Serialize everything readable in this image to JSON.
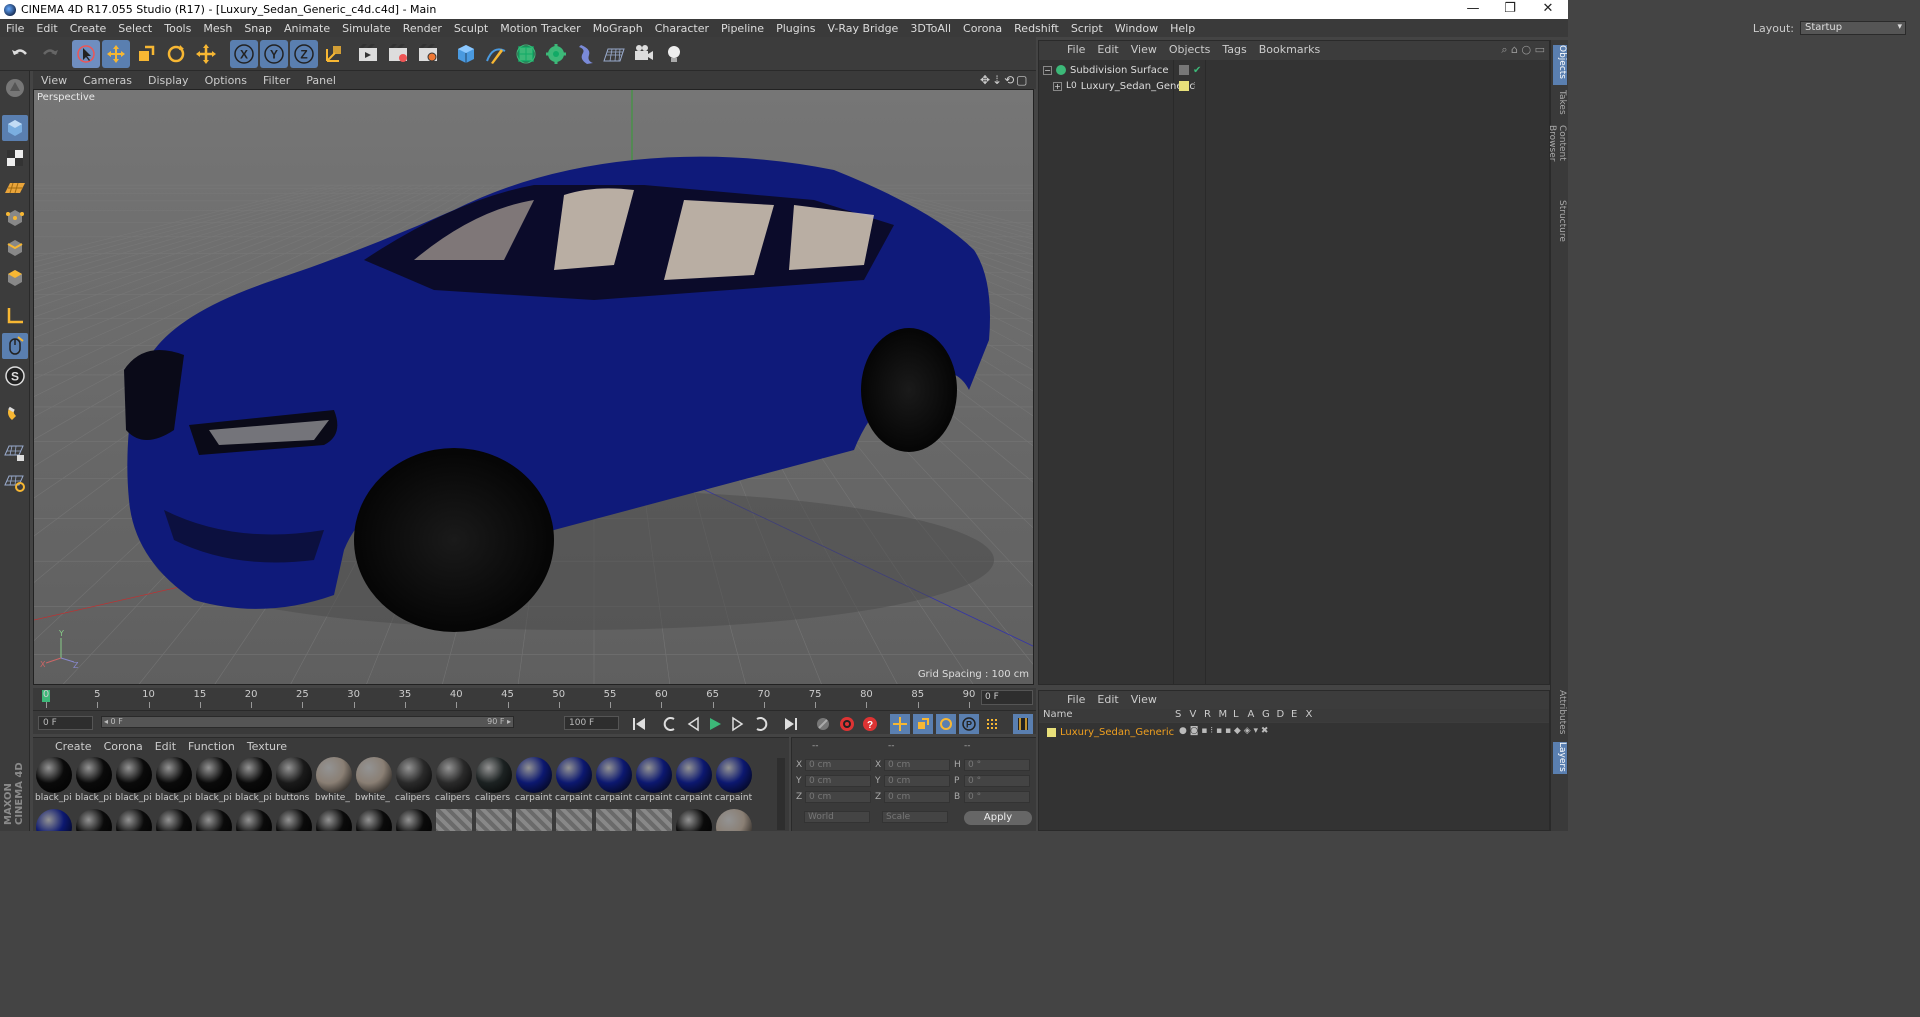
{
  "window": {
    "title": "CINEMA 4D R17.055 Studio (R17) - [Luxury_Sedan_Generic_c4d.c4d] - Main",
    "minimize": "—",
    "restore": "❐",
    "close": "✕"
  },
  "menu": [
    "File",
    "Edit",
    "Create",
    "Select",
    "Tools",
    "Mesh",
    "Snap",
    "Animate",
    "Simulate",
    "Render",
    "Sculpt",
    "Motion Tracker",
    "MoGraph",
    "Character",
    "Pipeline",
    "Plugins",
    "V-Ray Bridge",
    "3DToAll",
    "Corona",
    "Redshift",
    "Script",
    "Window",
    "Help"
  ],
  "layout": {
    "label": "Layout:",
    "value": "Startup"
  },
  "viewport": {
    "menu": [
      "View",
      "Cameras",
      "Display",
      "Options",
      "Filter",
      "Panel"
    ],
    "label": "Perspective",
    "grid_spacing": "Grid Spacing : 100 cm",
    "car_color": "#0f1a7a"
  },
  "timeline": {
    "ticks": [
      "0",
      "5",
      "10",
      "15",
      "20",
      "25",
      "30",
      "35",
      "40",
      "45",
      "50",
      "55",
      "60",
      "65",
      "70",
      "75",
      "80",
      "85",
      "90"
    ],
    "frame_field": "0 F",
    "start_field": "0 F",
    "slider_start": "◂ 0 F",
    "slider_end": "90 F ▸",
    "end_field": "100 F"
  },
  "materials": {
    "menu": [
      "Create",
      "Corona",
      "Edit",
      "Function",
      "Texture"
    ],
    "row1": [
      {
        "label": "black_pi",
        "color": "#0a0a0a"
      },
      {
        "label": "black_pi",
        "color": "#0a0a0a"
      },
      {
        "label": "black_pi",
        "color": "#0a0a0a"
      },
      {
        "label": "black_pi",
        "color": "#0a0a0a"
      },
      {
        "label": "black_pi",
        "color": "#0a0a0a"
      },
      {
        "label": "black_pi",
        "color": "#0a0a0a"
      },
      {
        "label": "buttons",
        "color": "#1a1a1a"
      },
      {
        "label": "bwhite_",
        "color": "#8a7f74"
      },
      {
        "label": "bwhite_",
        "color": "#8a7f74"
      },
      {
        "label": "calipers",
        "color": "#2a2a2a"
      },
      {
        "label": "calipers",
        "color": "#2a2a2a"
      },
      {
        "label": "calipers",
        "color": "#1c2222"
      },
      {
        "label": "carpaint",
        "color": "#0c1870"
      },
      {
        "label": "carpaint",
        "color": "#0c1870"
      },
      {
        "label": "carpaint",
        "color": "#0c1870"
      },
      {
        "label": "carpaint",
        "color": "#0c1870"
      },
      {
        "label": "carpaint",
        "color": "#0c1870"
      },
      {
        "label": "carpaint",
        "color": "#0c1870"
      }
    ],
    "row2": [
      "#0c1870",
      "#0a0a0a",
      "#0a0a0a",
      "#0a0a0a",
      "#0a0a0a",
      "#0a0a0a",
      "#0a0a0a",
      "#0a0a0a",
      "#0a0a0a",
      "#0a0a0a",
      "#777",
      "#777",
      "#777",
      "#777",
      "#777",
      "#777",
      "#0a0a0a",
      "#8a7f74"
    ]
  },
  "coords": {
    "headers": [
      "--",
      "--",
      "--"
    ],
    "rows": [
      {
        "l1": "X",
        "v1": "0 cm",
        "l2": "X",
        "v2": "0 cm",
        "l3": "H",
        "v3": "0 °"
      },
      {
        "l1": "Y",
        "v1": "0 cm",
        "l2": "Y",
        "v2": "0 cm",
        "l3": "P",
        "v3": "0 °"
      },
      {
        "l1": "Z",
        "v1": "0 cm",
        "l2": "Z",
        "v2": "0 cm",
        "l3": "B",
        "v3": "0 °"
      }
    ],
    "mode1": "World",
    "mode2": "Scale",
    "apply": "Apply"
  },
  "objects": {
    "menu": [
      "File",
      "Edit",
      "View",
      "Objects",
      "Tags",
      "Bookmarks"
    ],
    "items": [
      {
        "name": "Subdivision Surface",
        "color": "#ddd"
      },
      {
        "name": "Luxury_Sedan_Generic",
        "color": "#ddd"
      }
    ]
  },
  "side_tabs": [
    "Objects",
    "Takes",
    "Content Browser",
    "Structure"
  ],
  "side_tabs_lower": [
    "Attributes",
    "Layers"
  ],
  "layers": {
    "menu": [
      "File",
      "Edit",
      "View"
    ],
    "columns": [
      "Name",
      "S",
      "V",
      "R",
      "M",
      "L",
      "A",
      "G",
      "D",
      "E",
      "X"
    ],
    "items": [
      {
        "name": "Luxury_Sedan_Generic",
        "color": "#f0a020"
      }
    ]
  },
  "logo": {
    "line1": "MAXON",
    "line2": "CINEMA 4D"
  }
}
